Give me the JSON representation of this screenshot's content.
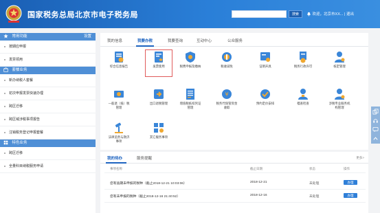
{
  "header": {
    "title": "国家税务总局北京市电子税务局",
    "search_button": "搜索",
    "user_text": "欢迎，北京市XX... | 退出"
  },
  "sidebar": {
    "sections": [
      {
        "title": "常用功能",
        "settings_label": "设置",
        "items": [
          "按期应申报",
          "发票领用"
        ]
      },
      {
        "title": "套餐业务",
        "items": [
          "新办纳税人套餐",
          "初次申报发票快速办理",
          "跨区迁移",
          "跨区域涉税事项报告",
          "注销税务登记申报套餐"
        ]
      },
      {
        "title": "特色业务",
        "items": [
          "跨区迁移",
          "全量科目纳税服务申请"
        ]
      }
    ]
  },
  "main_tabs": [
    "我的信息",
    "我要办税",
    "我要查询",
    "互动中心",
    "公众服务"
  ],
  "functions": [
    {
      "label": "综合信息报告",
      "label2": ""
    },
    {
      "label": "发票使用",
      "label2": ""
    },
    {
      "label": "税费申报及缴纳",
      "label2": ""
    },
    {
      "label": "税收减免",
      "label2": ""
    },
    {
      "label": "证明开具",
      "label2": ""
    },
    {
      "label": "税务行政许可",
      "label2": ""
    },
    {
      "label": "核定管理",
      "label2": ""
    },
    {
      "label": "一般退（抵）税",
      "label2": "管理"
    },
    {
      "label": "出口退税管理",
      "label2": ""
    },
    {
      "label": "增值税抵扣凭证",
      "label2": "管理"
    },
    {
      "label": "税务代保管资金",
      "label2": "收取"
    },
    {
      "label": "预约定价安排",
      "label2": ""
    },
    {
      "label": "稽查检查",
      "label2": ""
    },
    {
      "label": "涉税专业服务机",
      "label2": "构管理"
    },
    {
      "label": "法律追责与救济",
      "label2": "事项"
    },
    {
      "label": "其它服务事项",
      "label2": ""
    }
  ],
  "todo": {
    "tabs": [
      "我的待办",
      "服务提醒"
    ],
    "more": "更多>",
    "columns": [
      "事项名称",
      "截止日期",
      "状态",
      "操作"
    ],
    "rows": [
      {
        "name": "您有逾期未申报的税种（截止2018-12-21 10:03:06）",
        "date": "2018-12-21",
        "status": "未处理",
        "action": "办理"
      },
      {
        "name": "您有未申报的税种（截止2018-12-16 21:40:52）",
        "date": "2018-12-16",
        "status": "未处理",
        "action": "办理"
      }
    ]
  }
}
